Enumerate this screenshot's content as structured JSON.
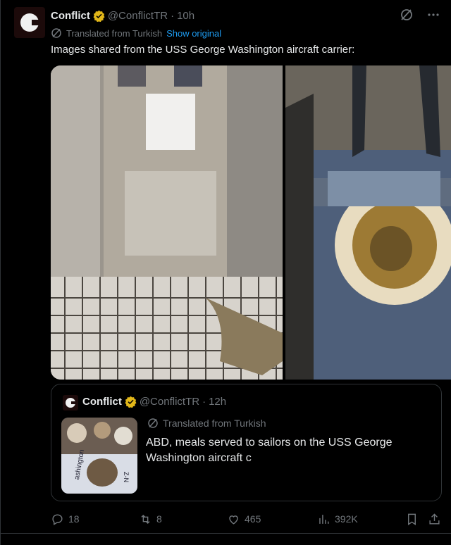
{
  "post": {
    "author_name": "Conflict",
    "author_handle": "@ConflictTR",
    "separator": "·",
    "time": "10h",
    "verified": true,
    "translated_label": "Translated from Turkish",
    "show_original_label": "Show original",
    "text": "Images shared from the USS George Washington aircraft carrier:",
    "media": [
      {
        "alt": "photo-1"
      },
      {
        "alt": "photo-2"
      }
    ]
  },
  "quote": {
    "author_name": "Conflict",
    "author_handle": "@ConflictTR",
    "separator": "·",
    "time": "12h",
    "translated_label": "Translated from Turkish",
    "text": "ABD, meals served to sailors on the USS George Washington aircraft c",
    "thumb_text_1": "ashington",
    "thumb_text_2": "Z-N"
  },
  "actions": {
    "replies": "18",
    "reposts": "8",
    "likes": "465",
    "views": "392K"
  },
  "icons": {
    "verified_badge": "verified-badge-icon",
    "grok": "grok-icon",
    "more": "more-icon",
    "translate": "translate-icon",
    "reply": "reply-icon",
    "repost": "repost-icon",
    "like": "like-icon",
    "views": "views-icon",
    "bookmark": "bookmark-icon",
    "share": "share-icon"
  },
  "colors": {
    "background": "#000000",
    "text_primary": "#e7e9ea",
    "text_secondary": "#71767b",
    "link": "#1d9bf0",
    "verified_gold": "#e2b719",
    "border": "#2f3336"
  }
}
